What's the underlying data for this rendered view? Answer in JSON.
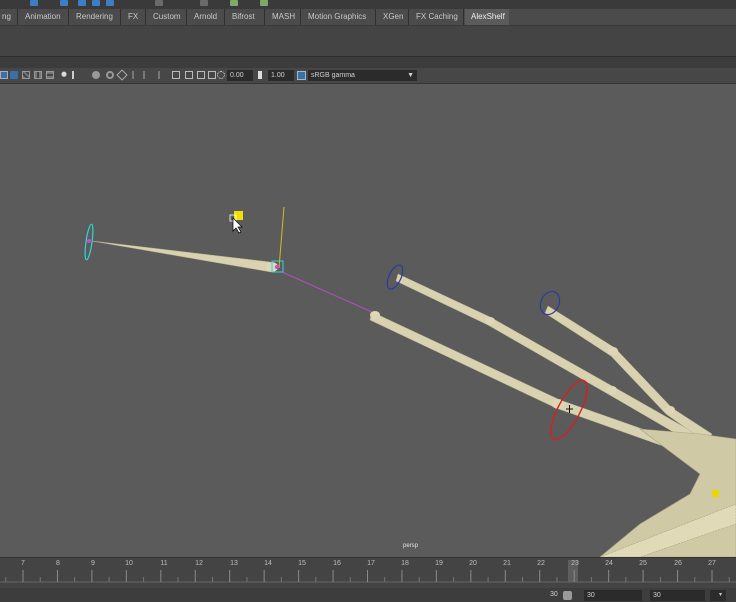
{
  "top_strip": {
    "icon_colors": [
      "#3d7fc4",
      "#3d7fc4",
      "#3d7fc4",
      "#3d7fc4"
    ]
  },
  "shelf": {
    "tabs": [
      {
        "label": "ng"
      },
      {
        "label": "Animation"
      },
      {
        "label": "Rendering"
      },
      {
        "label": "FX"
      },
      {
        "label": "Custom"
      },
      {
        "label": "Arnold"
      },
      {
        "label": "Bifrost"
      },
      {
        "label": "MASH"
      },
      {
        "label": "Motion Graphics"
      },
      {
        "label": "XGen"
      },
      {
        "label": "FX Caching"
      },
      {
        "label": "AlexShelf",
        "active": true
      }
    ]
  },
  "panel_toolbar": {
    "exposure_value": "0.00",
    "gamma_value": "1.00",
    "color_space": "sRGB gamma",
    "icons": [
      "wireframe-icon",
      "smooth-shade-icon",
      "textured-icon",
      "lights-icon",
      "shadows-icon",
      "ambient-occlusion-icon",
      "motion-blur-icon",
      "antialias-icon",
      "depth-of-field-icon",
      "isolate-select-icon",
      "xray-icon",
      "xray-joints-icon",
      "backface-icon",
      "exposure-icon",
      "gamma-icon",
      "color-management-icon"
    ]
  },
  "viewport": {
    "camera_label": "persp",
    "background_color": "#5b5b5b",
    "bone_color": "#d8d2b0",
    "controls": {
      "selected_control_color": "#d81f1f",
      "fk_control_color": "#2b3aa0",
      "cyan_control_color": "#2fd6d6",
      "aim_line_color": "#d0c020",
      "pole_vector_line_color": "#b050c0",
      "locator_color": "#f0e000"
    }
  },
  "time_slider": {
    "frames": [
      "7",
      "8",
      "9",
      "10",
      "11",
      "12",
      "13",
      "14",
      "15",
      "16",
      "17",
      "18",
      "19",
      "20",
      "21",
      "22",
      "23",
      "24",
      "25",
      "26",
      "27"
    ],
    "current_frame": "23"
  },
  "range": {
    "start_label": "30",
    "field_1": "30",
    "field_2": "30"
  }
}
